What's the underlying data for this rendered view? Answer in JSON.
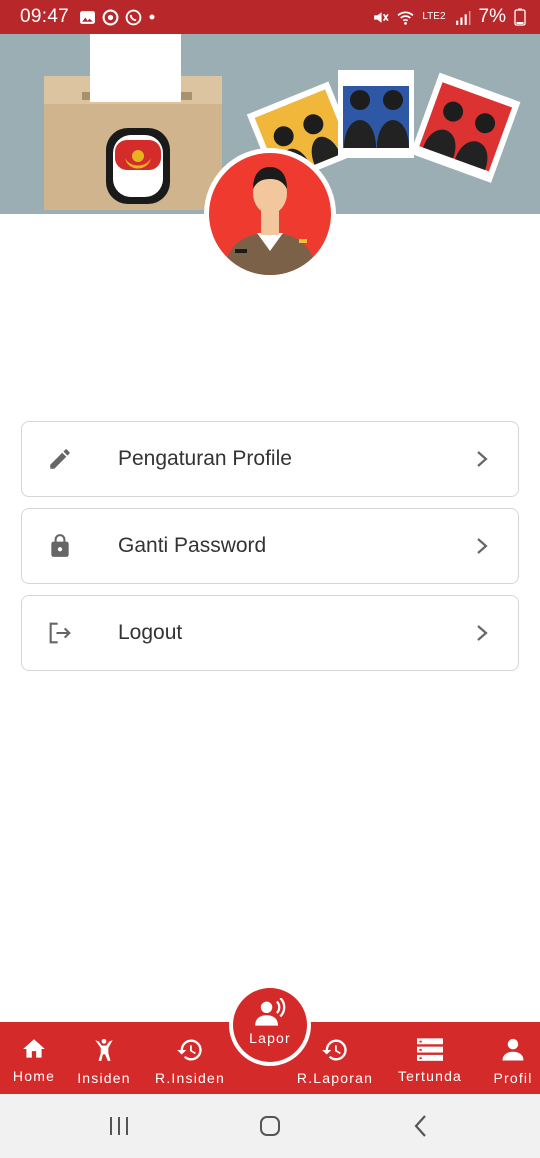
{
  "status_bar": {
    "time": "09:47",
    "battery": "7%",
    "network": "LTE2",
    "icons": [
      "gallery-icon",
      "sync-icon",
      "whatsapp-icon",
      "dot-icon",
      "mute-icon",
      "wifi-icon",
      "signal-icon",
      "battery-icon"
    ]
  },
  "header": {
    "banner": "election-illustration",
    "avatar": "officer-avatar"
  },
  "menu": {
    "items": [
      {
        "label": "Pengaturan Profile",
        "icon": "pencil-icon"
      },
      {
        "label": "Ganti Password",
        "icon": "lock-icon"
      },
      {
        "label": "Logout",
        "icon": "logout-icon"
      }
    ]
  },
  "bottom_nav": {
    "items": [
      {
        "label": "Home",
        "icon": "home-icon"
      },
      {
        "label": "Insiden",
        "icon": "person-icon"
      },
      {
        "label": "R.Insiden",
        "icon": "history-icon"
      },
      {
        "label": "Lapor",
        "icon": "report-voice-icon"
      },
      {
        "label": "R.Laporan",
        "icon": "history-icon"
      },
      {
        "label": "Tertunda",
        "icon": "list-icon"
      },
      {
        "label": "Profil",
        "icon": "profile-icon"
      }
    ]
  },
  "colors": {
    "primary": "#d52a2a",
    "status_bar": "#b8272a",
    "banner": "#9aaeb4",
    "avatar_bg": "#ee3a2f"
  }
}
